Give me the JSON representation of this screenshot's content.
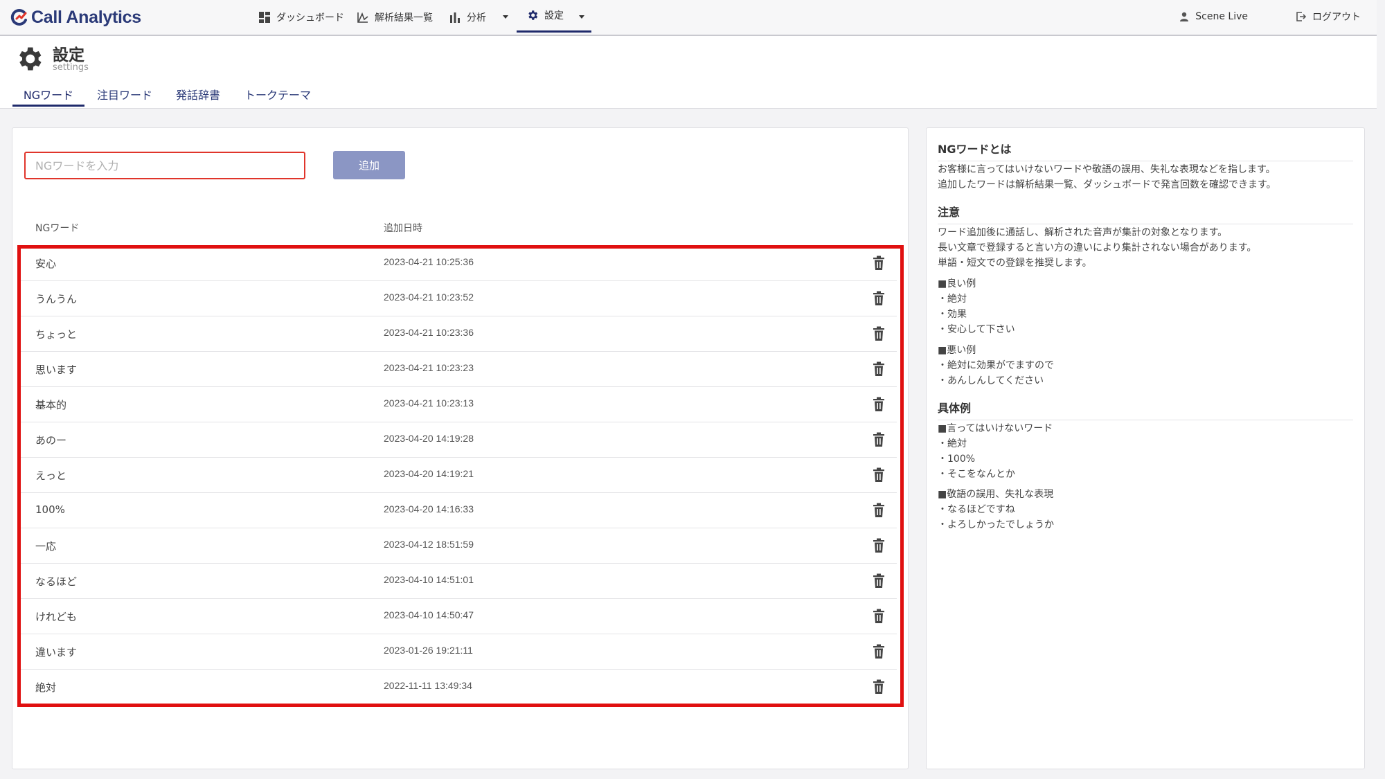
{
  "app": {
    "name": "Call Analytics",
    "brand_color": "#2b3a78",
    "accent_red": "#e0352b"
  },
  "nav": {
    "items": [
      {
        "label": "ダッシュボード",
        "icon": "dashboard-icon"
      },
      {
        "label": "解析結果一覧",
        "icon": "chart-line-icon"
      },
      {
        "label": "分析",
        "icon": "bar-chart-icon"
      },
      {
        "label": "設定",
        "icon": "gear-icon",
        "active": true
      }
    ],
    "user": "Scene Live",
    "logout": "ログアウト"
  },
  "page": {
    "title": "設定",
    "subtitle": "settings",
    "tabs": [
      {
        "label": "NGワード",
        "active": true
      },
      {
        "label": "注目ワード"
      },
      {
        "label": "発話辞書"
      },
      {
        "label": "トークテーマ"
      }
    ]
  },
  "form": {
    "placeholder": "NGワードを入力",
    "add_label": "追加"
  },
  "table": {
    "headers": [
      "NGワード",
      "追加日時"
    ],
    "rows": [
      {
        "word": "安心",
        "date": "2023-04-21 10:25:36"
      },
      {
        "word": "うんうん",
        "date": "2023-04-21 10:23:52"
      },
      {
        "word": "ちょっと",
        "date": "2023-04-21 10:23:36"
      },
      {
        "word": "思います",
        "date": "2023-04-21 10:23:23"
      },
      {
        "word": "基本的",
        "date": "2023-04-21 10:23:13"
      },
      {
        "word": "あのー",
        "date": "2023-04-20 14:19:28"
      },
      {
        "word": "えっと",
        "date": "2023-04-20 14:19:21"
      },
      {
        "word": "100%",
        "date": "2023-04-20 14:16:33"
      },
      {
        "word": "一応",
        "date": "2023-04-12 18:51:59"
      },
      {
        "word": "なるほど",
        "date": "2023-04-10 14:51:01"
      },
      {
        "word": "けれども",
        "date": "2023-04-10 14:50:47"
      },
      {
        "word": "違います",
        "date": "2023-01-26 19:21:11"
      },
      {
        "word": "絶対",
        "date": "2022-11-11 13:49:34"
      }
    ]
  },
  "side": {
    "h1": "NGワードとは",
    "p1": "お客様に言ってはいけないワードや敬語の誤用、失礼な表現などを指します。\n追加したワードは解析結果一覧、ダッシュボードで発言回数を確認できます。",
    "h2": "注意",
    "p2": "ワード追加後に通話し、解析された音声が集計の対象となります。\n長い文章で登録すると言い方の違いにより集計されない場合があります。\n単語・短文での登録を推奨します。",
    "good": "■良い例\n・絶対\n・効果\n・安心して下さい",
    "bad": "■悪い例\n・絶対に効果がでますので\n・あんしんしてください",
    "h3": "具体例",
    "ex1": "■言ってはいけないワード\n・絶対\n・100%\n・そこをなんとか",
    "ex2": "■敬語の誤用、失礼な表現\n・なるほどですね\n・よろしかったでしょうか"
  }
}
